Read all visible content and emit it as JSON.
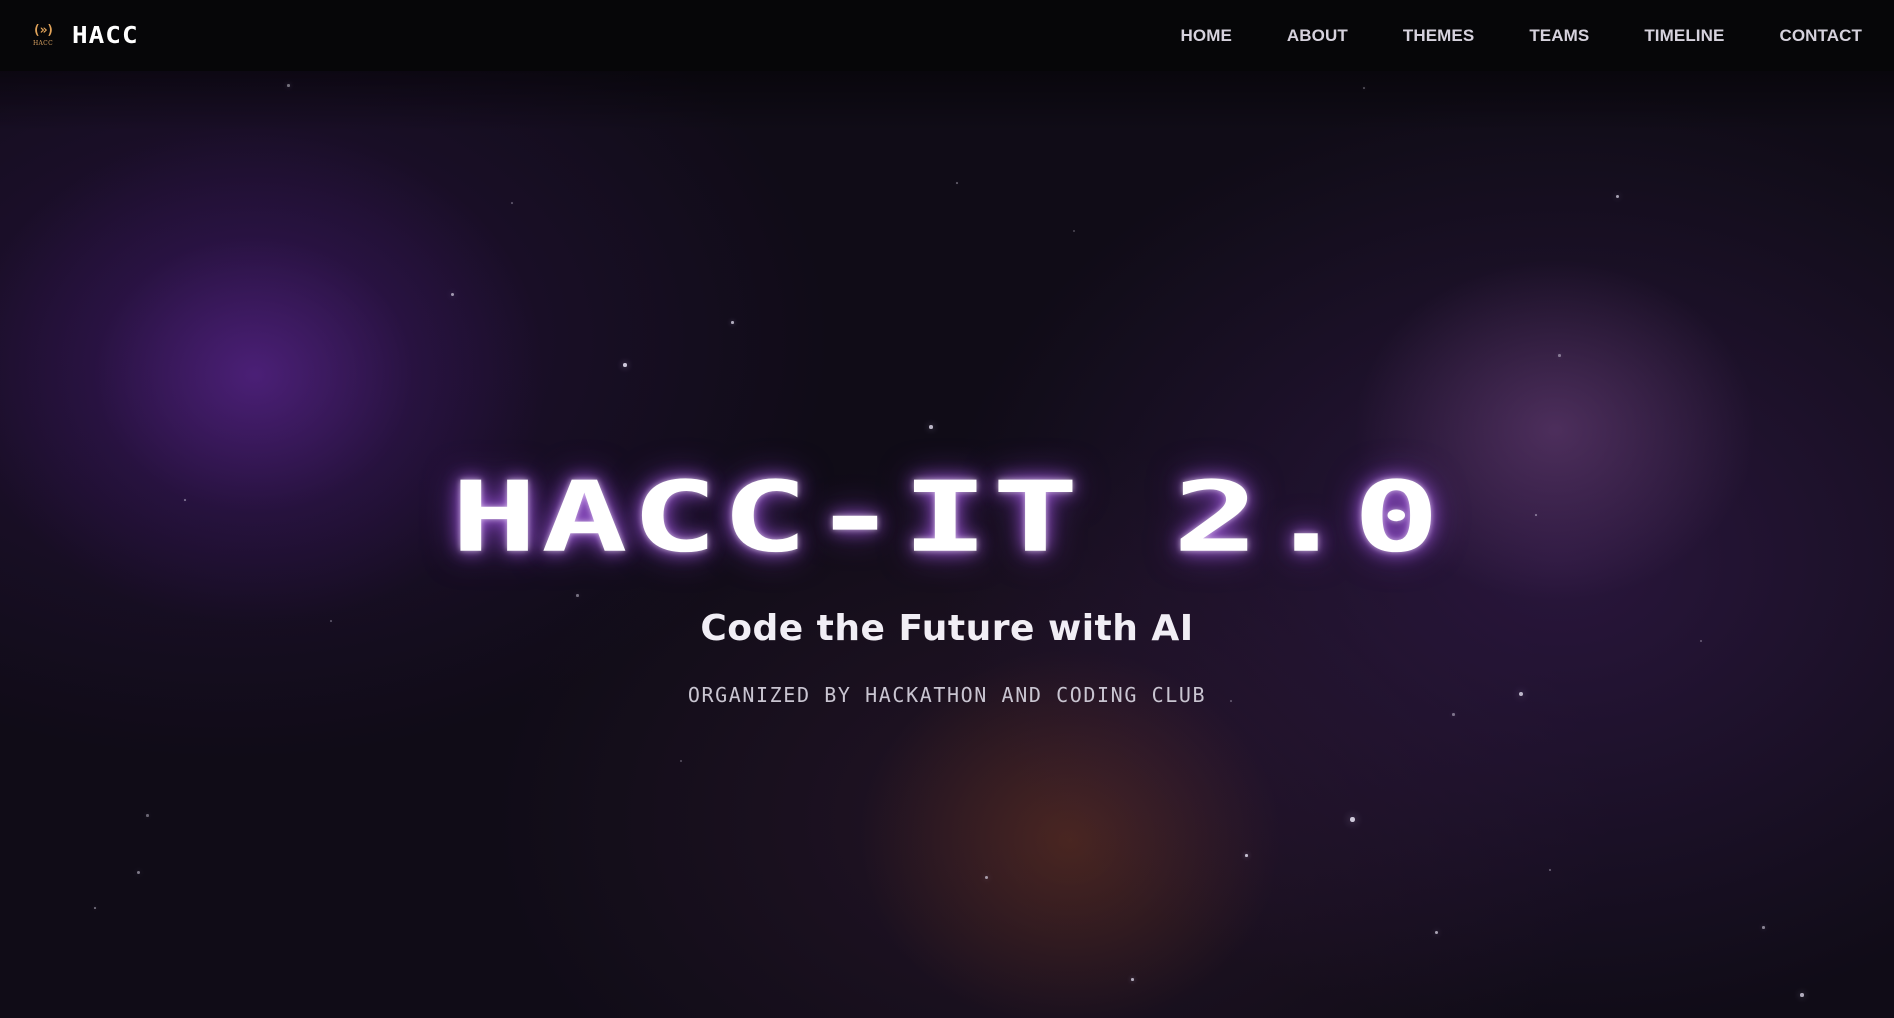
{
  "nav": {
    "logo_glyph": "(»)",
    "logo_sub": "HACC",
    "brand": "HACC",
    "links": [
      "HOME",
      "ABOUT",
      "THEMES",
      "TEAMS",
      "TIMELINE",
      "CONTACT"
    ]
  },
  "hero": {
    "title": "HACC-IT 2.0",
    "tagline": "Code the Future with AI",
    "organizer": "ORGANIZED BY HACKATHON AND CODING CLUB"
  },
  "colors": {
    "background": "#100c17",
    "navbar": "#060608",
    "accent_glow": "#a855f7",
    "logo_accent": "#e2a45a"
  }
}
